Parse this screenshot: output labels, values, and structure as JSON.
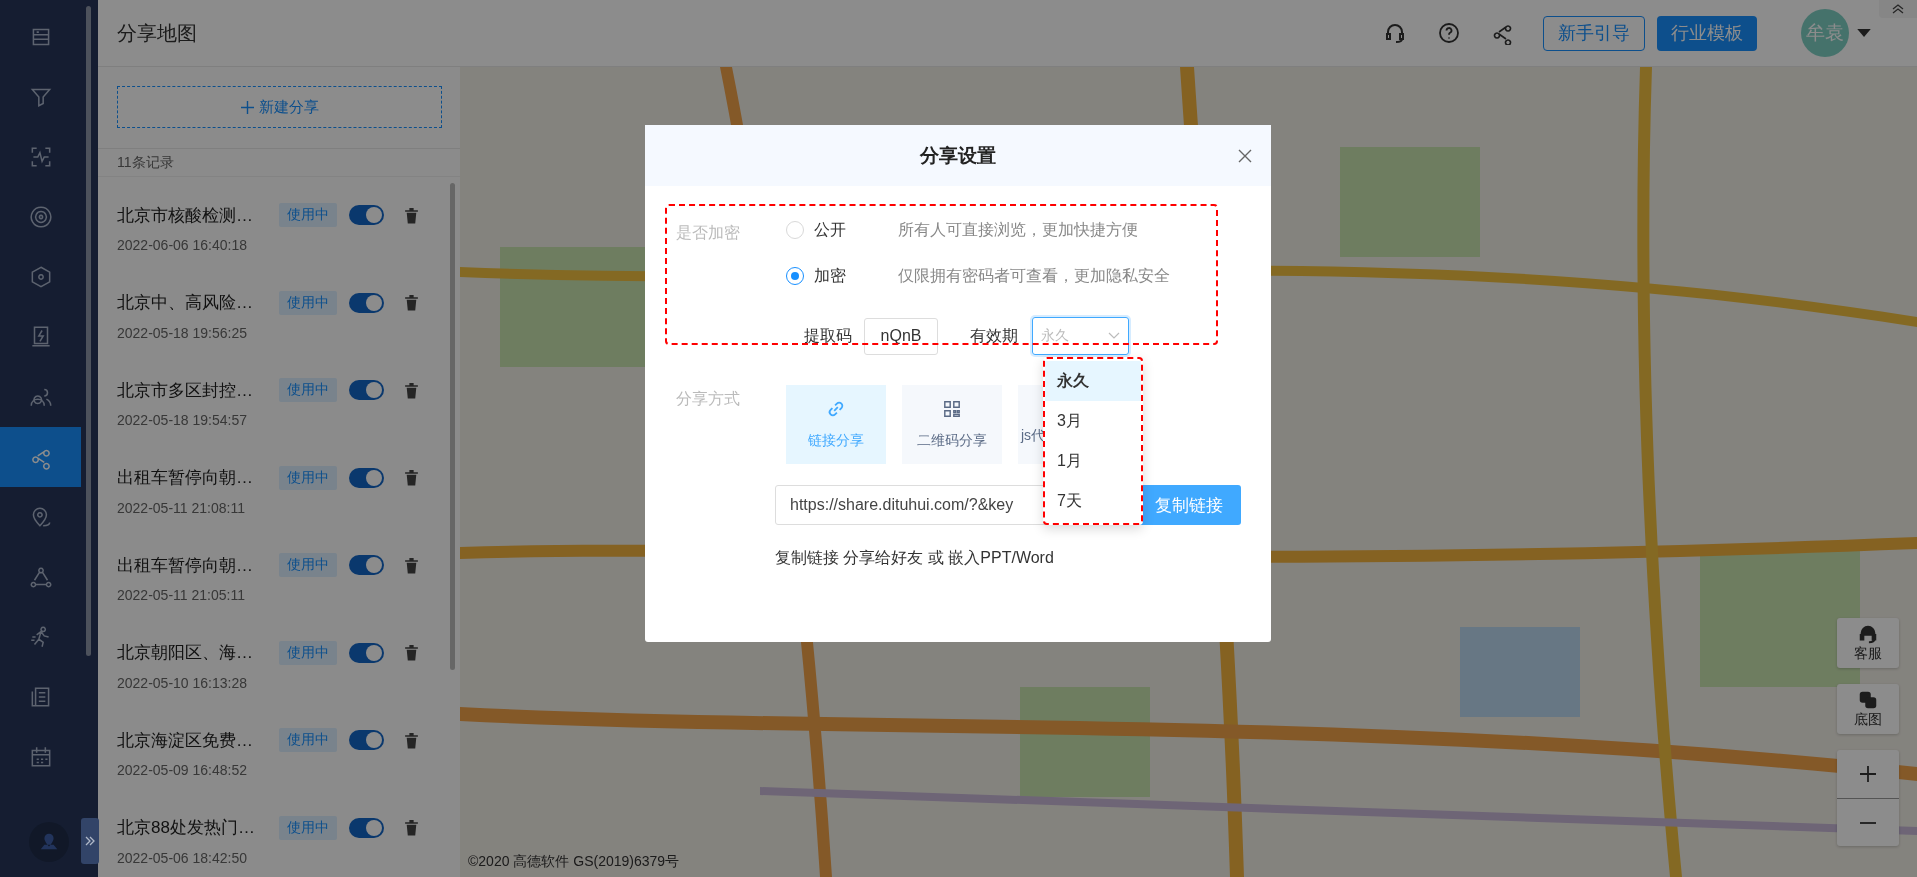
{
  "nav": {
    "items": [
      {
        "selected": false
      },
      {
        "selected": false
      },
      {
        "selected": false
      },
      {
        "selected": false
      },
      {
        "selected": false
      },
      {
        "selected": false
      },
      {
        "selected": false
      },
      {
        "selected": true
      },
      {
        "selected": false
      },
      {
        "selected": false
      },
      {
        "selected": false
      },
      {
        "selected": false
      },
      {
        "selected": false
      }
    ]
  },
  "header": {
    "title": "分享地图",
    "buttons": [
      {
        "label": "新手引导",
        "kind": "outline"
      },
      {
        "label": "行业模板",
        "kind": "primary"
      }
    ],
    "avatar": "牟袁"
  },
  "panel": {
    "new_button": "新建分享",
    "record_count": "11条记录",
    "shares": [
      {
        "title": "北京市核酸检测…",
        "status": "使用中",
        "on": true,
        "date": "2022-06-06 16:40:18"
      },
      {
        "title": "北京中、高风险…",
        "status": "使用中",
        "on": true,
        "date": "2022-05-18 19:56:25"
      },
      {
        "title": "北京市多区封控…",
        "status": "使用中",
        "on": true,
        "date": "2022-05-18 19:54:57"
      },
      {
        "title": "出租车暂停向朝…",
        "status": "使用中",
        "on": true,
        "date": "2022-05-11 21:08:11"
      },
      {
        "title": "出租车暂停向朝…",
        "status": "使用中",
        "on": true,
        "date": "2022-05-11 21:05:11"
      },
      {
        "title": "北京朝阳区、海…",
        "status": "使用中",
        "on": true,
        "date": "2022-05-10 16:13:28"
      },
      {
        "title": "北京海淀区免费…",
        "status": "使用中",
        "on": true,
        "date": "2022-05-09 16:48:52"
      },
      {
        "title": "北京88处发热门…",
        "status": "使用中",
        "on": true,
        "date": "2022-05-06 18:42:50"
      }
    ]
  },
  "map": {
    "controls": [
      "客服",
      "底图"
    ],
    "copyright": "©2020 高德软件 GS(2019)6379号"
  },
  "dialog": {
    "title": "分享设置",
    "encryption": {
      "label": "是否加密",
      "options": [
        {
          "label": "公开",
          "description": "所有人可直接浏览，更加快捷方便",
          "selected": false
        },
        {
          "label": "加密",
          "description": "仅限拥有密码者可查看，更加隐私安全",
          "selected": true
        }
      ]
    },
    "code": {
      "label": "提取码",
      "value": "nQnB"
    },
    "validity": {
      "label": "有效期",
      "placeholder": "永久",
      "expanded": true,
      "options": [
        {
          "label": "永久",
          "selected": true
        },
        {
          "label": "3月",
          "selected": false
        },
        {
          "label": "1月",
          "selected": false
        },
        {
          "label": "7天",
          "selected": false
        }
      ]
    },
    "method": {
      "label": "分享方式",
      "tabs": [
        {
          "label": "链接分享",
          "selected": true
        },
        {
          "label": "二维码分享",
          "selected": false
        },
        {
          "label": "js代",
          "selected": false
        }
      ]
    },
    "link": {
      "value": "https://share.dituhui.com/?&key",
      "button": "复制链接"
    },
    "hint": "复制链接 分享给好友 或 嵌入PPT/Word"
  }
}
